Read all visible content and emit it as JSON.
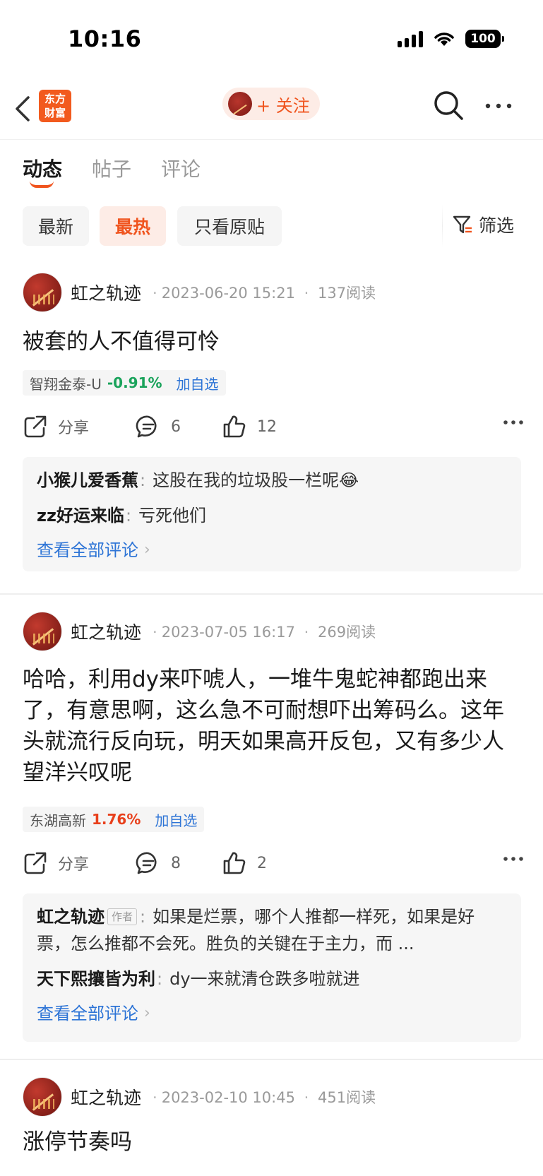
{
  "status_bar": {
    "time": "10:16",
    "battery": "100"
  },
  "nav": {
    "logo_line1": "东方",
    "logo_line2": "财富",
    "follow_label": "+ 关注"
  },
  "tabs": [
    {
      "label": "动态",
      "active": true
    },
    {
      "label": "帖子"
    },
    {
      "label": "评论"
    }
  ],
  "filters": {
    "chips": [
      {
        "label": "最新"
      },
      {
        "label": "最热",
        "active": true
      },
      {
        "label": "只看原贴"
      }
    ],
    "filter_label": "筛选"
  },
  "posts": [
    {
      "author": "虹之轨迹",
      "date": "2023-06-20 15:21",
      "reads": "137阅读",
      "text": "被套的人不值得可怜",
      "stock": {
        "name": "智翔金泰-U",
        "change": "-0.91%",
        "add_label": "加自选"
      },
      "share_label": "分享",
      "comment_count": "6",
      "like_count": "12",
      "comments": [
        {
          "user": "小猴儿爱香蕉",
          "text": "这股在我的垃圾股一栏呢😂"
        },
        {
          "user": "zz好运来临",
          "text": "亏死他们"
        }
      ],
      "view_all": "查看全部评论"
    },
    {
      "author": "虹之轨迹",
      "date": "2023-07-05 16:17",
      "reads": "269阅读",
      "text": "哈哈，利用dy来吓唬人，一堆牛鬼蛇神都跑出来了，有意思啊，这么急不可耐想吓出筹码么。这年头就流行反向玩，明天如果高开反包，又有多少人望洋兴叹呢",
      "stock": {
        "name": "东湖高新",
        "change": "1.76%",
        "add_label": "加自选"
      },
      "share_label": "分享",
      "comment_count": "8",
      "like_count": "2",
      "comments": [
        {
          "user": "虹之轨迹",
          "badge": "作者",
          "text": "如果是烂票，哪个人推都一样死，如果是好票，怎么推都不会死。胜负的关键在于主力，而 ..."
        },
        {
          "user": "天下熙攘皆为利",
          "text": "dy一来就清仓跌多啦就进"
        }
      ],
      "view_all": "查看全部评论"
    },
    {
      "author": "虹之轨迹",
      "date": "2023-02-10 10:45",
      "reads": "451阅读",
      "text": "涨停节奏吗"
    }
  ],
  "colors": {
    "accent": "#f0541e",
    "link": "#2d74d6",
    "down": "#1aa35b",
    "up": "#e8401c"
  }
}
